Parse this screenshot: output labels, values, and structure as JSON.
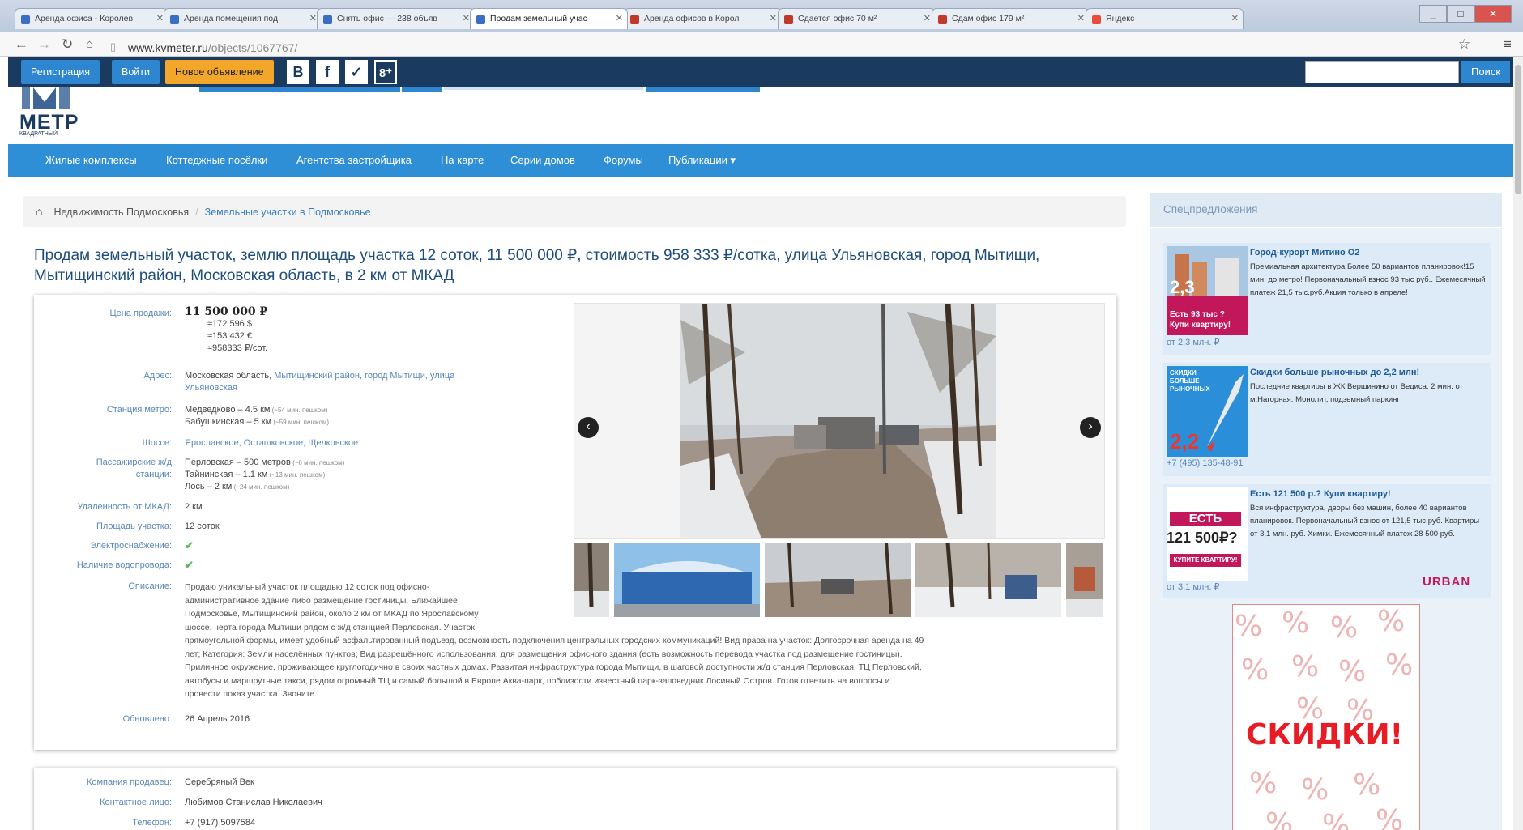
{
  "browser": {
    "tabs": [
      {
        "label": "Аренда офиса - Королев"
      },
      {
        "label": "Аренда помещения под"
      },
      {
        "label": "Снять офис — 238 объяв"
      },
      {
        "label": "Продам земельный учас"
      },
      {
        "label": "Аренда офисов в Корол"
      },
      {
        "label": "Сдается офис 70 м²"
      },
      {
        "label": "Сдам офис 179 м²"
      },
      {
        "label": "Яндекс"
      }
    ],
    "url_domain": "www.kvmeter.ru",
    "url_path": "/objects/1067767/",
    "win_min": "_",
    "win_max": "□",
    "win_close": "✕"
  },
  "topbar": {
    "register": "Регистрация",
    "login": "Войти",
    "new_ad": "Новое объявление",
    "social": [
      "B",
      "f",
      "✓",
      "8⁺"
    ],
    "search_button": "Поиск",
    "search_placeholder": ""
  },
  "logo": {
    "text": "МЕТР",
    "sub": "КВАДРАТНЫЙ"
  },
  "nav": {
    "items": [
      "Жилые комплексы",
      "Коттеджные посёлки",
      "Агентства застройщика",
      "На карте",
      "Серии домов",
      "Форумы",
      "Публикации ▾"
    ]
  },
  "breadcrumb": {
    "home_icon": "home-icon",
    "current": "Недвижимость Подмосковья",
    "separator": "/",
    "link": "Земельные участки в Подмосковье"
  },
  "title": "Продам земельный участок, землю площадь участка 12 соток, 11 500 000 ₽, стоимость 958 333 ₽/сотка, улица Ульяновская, город Мытищи, Мытищинский район, Московская область, в 2 км от МКАД",
  "listing": {
    "price_label": "Цена продажи:",
    "price": "11 500 000 ₽",
    "price_usd": "≈172 596 $",
    "price_eur": "≈153 432 €",
    "price_per": "≈958333 ₽/сот.",
    "address_label": "Адрес:",
    "address_plain": "Московская область,",
    "address_link1": " Мытищинский район, город Мытищи, улица",
    "address_link2": "Ульяновская",
    "metro_label": "Станция метро:",
    "metro1": "Медведково – 4.5 км",
    "metro1_note": " (~54 мин. пешком)",
    "metro2": "Бабушкинская – 5 км",
    "metro2_note": " (~59 мин. пешком)",
    "highway_label": "Шоссе:",
    "highway": "Ярославское, Осташковское, Щелковское",
    "rail_label1": "Пассажирские ж/д",
    "rail_label2": "станции:",
    "rail1": "Перловская – 500 метров",
    "rail1_note": " (~6 мин. пешком)",
    "rail2": "Тайнинская – 1.1 км",
    "rail2_note": " (~13 мин. пешком)",
    "rail3": "Лось – 2 км",
    "rail3_note": " (~24 мин. пешком)",
    "mkad_label": "Удаленность от МКАД:",
    "mkad": "2 км",
    "area_label": "Площадь участка:",
    "area": "12 соток",
    "power_label": "Электроснабжение:",
    "water_label": "Наличие водопровода:",
    "check": "✔",
    "desc_label": "Описание:",
    "desc_lines": [
      "Продаю уникальный участок площадью 12 соток под офисно-",
      "административное здание либо размещение гостиницы. Ближайшее",
      "Подмосковье, Мытищинский район, около 2 км от МКАД по Ярославскому",
      "шоссе, черта города Мытищи рядом с ж/д станцией Перловская. Участок",
      "прямоугольной формы, имеет удобный асфальтированный подъезд, возможность подключения центральных городских коммуникаций! Вид права на участок: Долгосрочная аренда на 49",
      "лет; Категория: Земли населённых пунктов; Вид разрешённого использования: для размещения офисного здания (есть возможность перевода участка под размещение гостиницы).",
      "Приличное окружение, проживающее круглогодично в своих частных домах. Развитая инфраструктура города Мытищи, в шаговой доступности ж/д станция Перловская, ТЦ Перловский,",
      "автобусы и маршрутные такси, рядом огромный ТЦ и самый большой в Европе Аква-парк, поблизости известный парк-заповедник Лосиный Остров. Готов ответить на вопросы и",
      "провести показ участка. Звоните."
    ],
    "updated_label": "Обновлено:",
    "updated": "26 Апрель 2016"
  },
  "gallery": {
    "prev": "‹",
    "next": "›"
  },
  "contact": {
    "company_label": "Компания продавец:",
    "company": "Серебряный Век",
    "person_label": "Контактное лицо:",
    "person": "Любимов Станислав Николаевич",
    "phone_label": "Телефон:",
    "phone": "+7 (917) 5097584"
  },
  "sidebar": {
    "heading": "Спецпредложения",
    "promos": [
      {
        "title": "Город-курорт Митино О2",
        "desc": "Премиальная архитектура!Более 50 вариантов планировок!15 мин. до метро! Первоначальный взнос 93 тыс руб.. Ежемесячный платеж 21,5 тыс.руб.Акция только в апреле!",
        "footer": "от 2,3 млн. ₽",
        "img_big": "2,3",
        "img_caption": "Есть 93 тыс ? Купи квартиру!"
      },
      {
        "title": "Скидки больше рыночных до 2,2 млн!",
        "desc": "Последние квартиры в ЖК Вершинино от Ведиса. 2 мин. от м.Нагорная. Монолит, подземный паркинг",
        "footer": "+7 (495) 135-48-91",
        "img_top": "СКИДКИ БОЛЬШЕ РЫНОЧНЫХ",
        "img_big": "2,2"
      },
      {
        "title": "Есть 121 500 р.? Купи квартиру!",
        "desc": "Вся инфраструктура, дворы без машин, более 40 вариантов планировок. Первоначальный взнос от 121,5 тыс руб. Квартиры от 3,1 млн. руб. Химки. Ежемесячный платеж 28 500 руб.",
        "footer": "от 3,1 млн. ₽",
        "img_top": "ЕСТЬ",
        "img_big": "121 500₽?",
        "img_caption": "КУПИТЕ КВАРТИРУ!",
        "brand": "URBAN"
      }
    ],
    "banner": {
      "text": "СКИДКИ!",
      "pattern": "%"
    }
  }
}
